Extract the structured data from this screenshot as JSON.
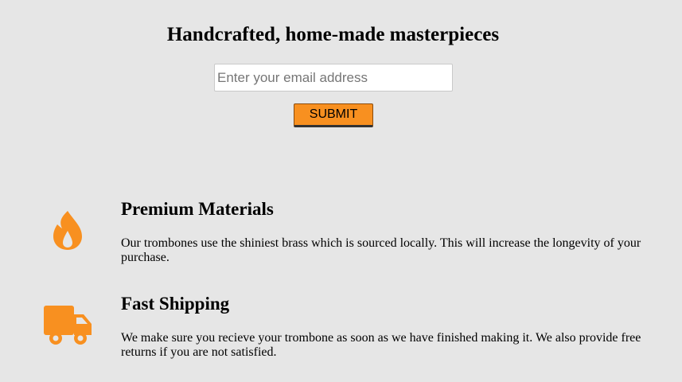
{
  "hero": {
    "title": "Handcrafted, home-made masterpieces"
  },
  "signup": {
    "email_placeholder": "Enter your email address",
    "submit_label": "SUBMIT"
  },
  "features": [
    {
      "icon": "flame-icon",
      "title": "Premium Materials",
      "description": "Our trombones use the shiniest brass which is sourced locally. This will increase the longevity of your purchase."
    },
    {
      "icon": "truck-icon",
      "title": "Fast Shipping",
      "description": "We make sure you recieve your trombone as soon as we have finished making it. We also provide free returns if you are not satisfied."
    }
  ],
  "colors": {
    "background": "#e6e6e6",
    "accent": "#f89020"
  }
}
